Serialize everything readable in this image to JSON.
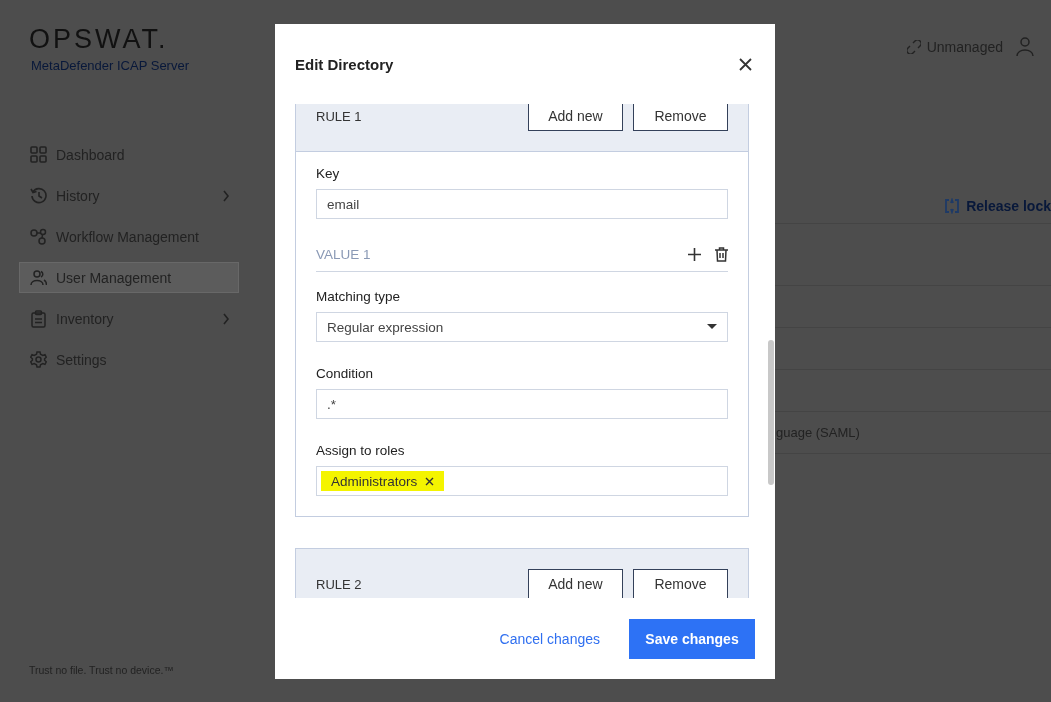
{
  "brand": {
    "logo": "OPSWAT.",
    "product": "MetaDefender ICAP Server"
  },
  "sidebar": {
    "items": [
      {
        "label": "Dashboard",
        "selected": false,
        "expandable": false
      },
      {
        "label": "History",
        "selected": false,
        "expandable": true
      },
      {
        "label": "Workflow Management",
        "selected": false,
        "expandable": false
      },
      {
        "label": "User Management",
        "selected": true,
        "expandable": false
      },
      {
        "label": "Inventory",
        "selected": false,
        "expandable": true
      },
      {
        "label": "Settings",
        "selected": false,
        "expandable": false
      }
    ],
    "footer": "Trust no file. Trust no device.™"
  },
  "topbar": {
    "status": "Unmanaged"
  },
  "content": {
    "action": "Release lock",
    "table_text": "guage (SAML)"
  },
  "dialog": {
    "title": "Edit Directory",
    "rules": [
      {
        "label": "RULE 1",
        "buttons": [
          "Add new",
          "Remove"
        ],
        "key": {
          "label": "Key",
          "value": "email"
        },
        "values": [
          {
            "label": "VALUE 1",
            "matching_type": {
              "label": "Matching type",
              "value": "Regular expression"
            },
            "condition": {
              "label": "Condition",
              "value": ".*"
            },
            "roles": {
              "label": "Assign to roles",
              "chips": [
                {
                  "text": "Administrators",
                  "highlighted": true
                }
              ]
            }
          }
        ]
      },
      {
        "label": "RULE 2",
        "buttons": [
          "Add new",
          "Remove"
        ]
      }
    ],
    "cancel": "Cancel changes",
    "save": "Save changes"
  }
}
